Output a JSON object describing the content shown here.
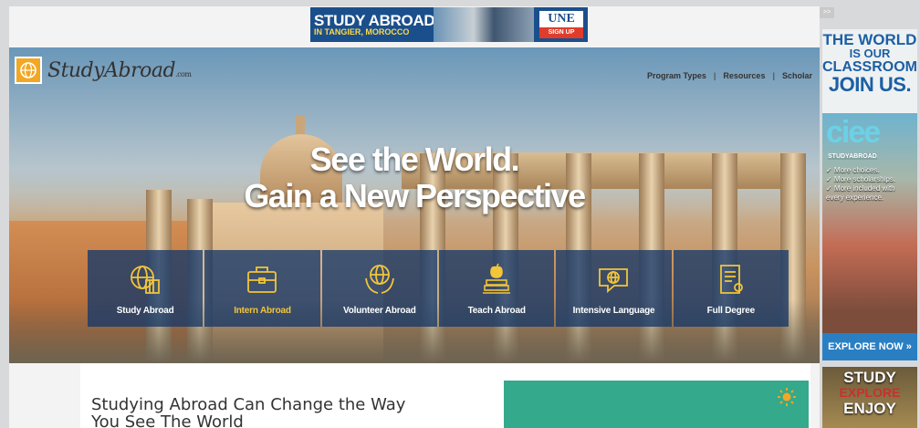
{
  "top_ad": {
    "title": "STUDY ABROAD",
    "subtitle": "IN TANGIER, MOROCCO",
    "brand": "UNE",
    "cta": "SIGN UP"
  },
  "site": {
    "logo_main": "StudyAbroad",
    "logo_suffix": ".com"
  },
  "nav": {
    "items": [
      "Program Types",
      "Resources",
      "Scholar"
    ]
  },
  "hero": {
    "headline_line1": "See the World.",
    "headline_line2": "Gain a New Perspective"
  },
  "categories": [
    {
      "label": "Study Abroad",
      "icon": "globe-books-icon",
      "active": false
    },
    {
      "label": "Intern Abroad",
      "icon": "briefcase-icon",
      "active": true
    },
    {
      "label": "Volunteer Abroad",
      "icon": "hands-globe-icon",
      "active": false
    },
    {
      "label": "Teach Abroad",
      "icon": "apple-books-icon",
      "active": false
    },
    {
      "label": "Intensive Language",
      "icon": "speech-globe-icon",
      "active": false
    },
    {
      "label": "Full Degree",
      "icon": "diploma-icon",
      "active": false
    }
  ],
  "content": {
    "heading": "Studying Abroad Can Change the Way You See The World"
  },
  "side_ad": {
    "line1": "THE WORLD",
    "line2": "IS OUR",
    "line3": "CLASSROOM.",
    "line4": "JOIN US.",
    "brand": "ciee",
    "brand_sub": "STUDYABROAD",
    "bullets": [
      "✓ More choices.",
      "✓ More scholarships.",
      "✓ More included with",
      "every experience."
    ],
    "cta": "EXPLORE NOW »"
  },
  "side_ad2": {
    "line1": "STUDY",
    "line2": "EXPLORE",
    "line3": "ENJOY"
  },
  "scroll_btn": ">>",
  "colors": {
    "nav_blue": "#163869",
    "active_yellow": "#f2c53a",
    "teal": "#34a98b",
    "logo_orange": "#f2a822"
  }
}
